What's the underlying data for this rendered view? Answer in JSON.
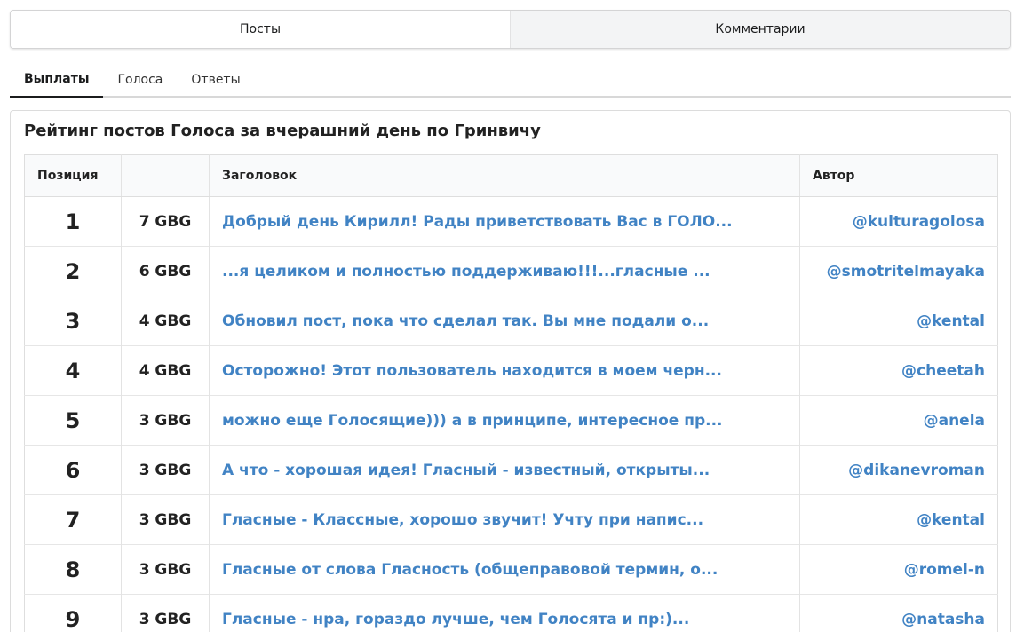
{
  "top_tabs": [
    {
      "label": "Посты",
      "active": false
    },
    {
      "label": "Комментарии",
      "active": true
    }
  ],
  "sub_tabs": [
    {
      "label": "Выплаты",
      "active": true
    },
    {
      "label": "Голоса",
      "active": false
    },
    {
      "label": "Ответы",
      "active": false
    }
  ],
  "card": {
    "title": "Рейтинг постов Голоса за вчерашний день по Гринвичу",
    "columns": [
      "Позиция",
      "",
      "Заголовок",
      "Автор"
    ],
    "rows": [
      {
        "position": "1",
        "payout": "7 GBG",
        "title": "Добрый день Кирилл! Рады приветствовать Вас в ГОЛО...",
        "author": "@kulturagolosa"
      },
      {
        "position": "2",
        "payout": "6 GBG",
        "title": "...я целиком и полностью поддерживаю!!!...гласные ...",
        "author": "@smotritelmayaka"
      },
      {
        "position": "3",
        "payout": "4 GBG",
        "title": "Обновил пост, пока что сделал так. Вы мне подали о...",
        "author": "@kental"
      },
      {
        "position": "4",
        "payout": "4 GBG",
        "title": "Осторожно! Этот пользователь находится в моем черн...",
        "author": "@cheetah"
      },
      {
        "position": "5",
        "payout": "3 GBG",
        "title": "можно еще Голосящие))) а в принципе, интересное пр...",
        "author": "@anela"
      },
      {
        "position": "6",
        "payout": "3 GBG",
        "title": "А что - хорошая идея! Гласный - известный, открыты...",
        "author": "@dikanevroman"
      },
      {
        "position": "7",
        "payout": "3 GBG",
        "title": "Гласные - Классные, хорошо звучит! Учту при напис...",
        "author": "@kental"
      },
      {
        "position": "8",
        "payout": "3 GBG",
        "title": "Гласные от слова Гласность (общеправовой термин, о...",
        "author": "@romel-n"
      },
      {
        "position": "9",
        "payout": "3 GBG",
        "title": "Гласные - нра, гораздо лучше, чем Голосята и пр:)...",
        "author": "@natasha"
      }
    ]
  },
  "colors": {
    "link": "#4183c4",
    "active_segment_bg": "#f3f4f5",
    "header_bg": "#f9fafb"
  }
}
